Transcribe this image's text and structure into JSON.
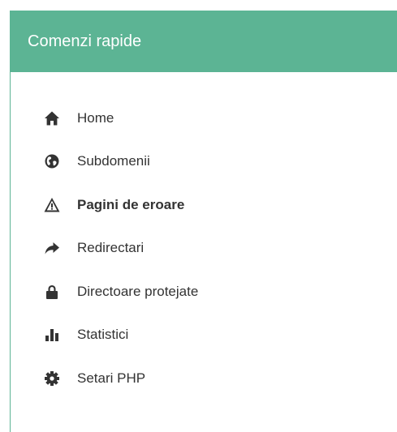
{
  "panel": {
    "title": "Comenzi rapide",
    "header_color": "#5cb494"
  },
  "menu": {
    "items": [
      {
        "label": "Home",
        "icon": "home-icon",
        "active": false
      },
      {
        "label": "Subdomenii",
        "icon": "globe-icon",
        "active": false
      },
      {
        "label": "Pagini de eroare",
        "icon": "warning-icon",
        "active": true
      },
      {
        "label": "Redirectari",
        "icon": "redirect-arrow-icon",
        "active": false
      },
      {
        "label": "Directoare protejate",
        "icon": "lock-icon",
        "active": false
      },
      {
        "label": "Statistici",
        "icon": "bar-chart-icon",
        "active": false
      },
      {
        "label": "Setari PHP",
        "icon": "gear-icon",
        "active": false
      }
    ]
  }
}
